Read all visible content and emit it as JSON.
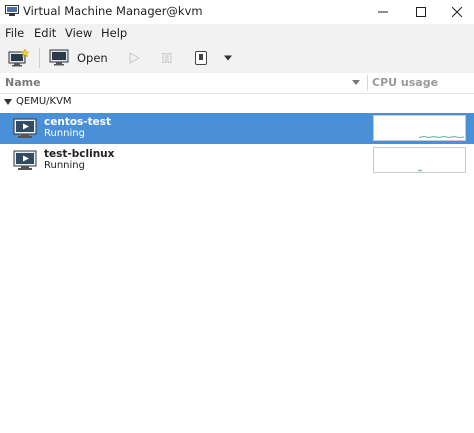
{
  "window": {
    "title": "Virtual Machine Manager@kvm"
  },
  "menubar": {
    "items": [
      "File",
      "Edit",
      "View",
      "Help"
    ]
  },
  "toolbar": {
    "open_label": "Open"
  },
  "list": {
    "columns": {
      "name": "Name",
      "cpu": "CPU usage"
    },
    "group": "QEMU/KVM",
    "vms": [
      {
        "name": "centos-test",
        "status": "Running",
        "selected": true
      },
      {
        "name": "test-bclinux",
        "status": "Running",
        "selected": false
      }
    ]
  },
  "colors": {
    "selection": "#4a90d9",
    "graph_line": "#5bb5a2"
  }
}
